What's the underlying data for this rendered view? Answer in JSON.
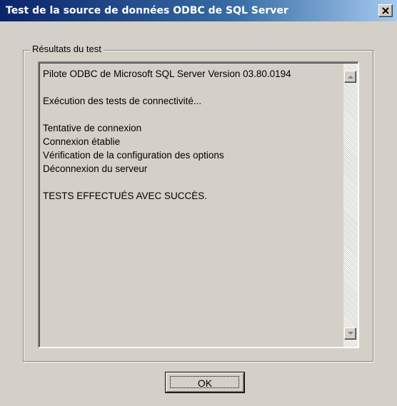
{
  "window": {
    "title": "Test de la source de données ODBC de SQL Server",
    "close_icon": "close-icon"
  },
  "group": {
    "label": "Résultats du test"
  },
  "results": {
    "lines": [
      "Pilote ODBC de Microsoft SQL Server Version 03.80.0194",
      "",
      "Exécution des tests de connectivité...",
      "",
      "Tentative de connexion",
      "Connexion établie",
      "Vérification de la configuration des options",
      "Déconnexion du serveur",
      "",
      "TESTS EFFECTUÉS AVEC SUCCÈS."
    ]
  },
  "buttons": {
    "ok_label": "OK"
  },
  "colors": {
    "titlebar_start": "#0a246a",
    "titlebar_end": "#a6caf0",
    "face": "#d4d0c8"
  }
}
